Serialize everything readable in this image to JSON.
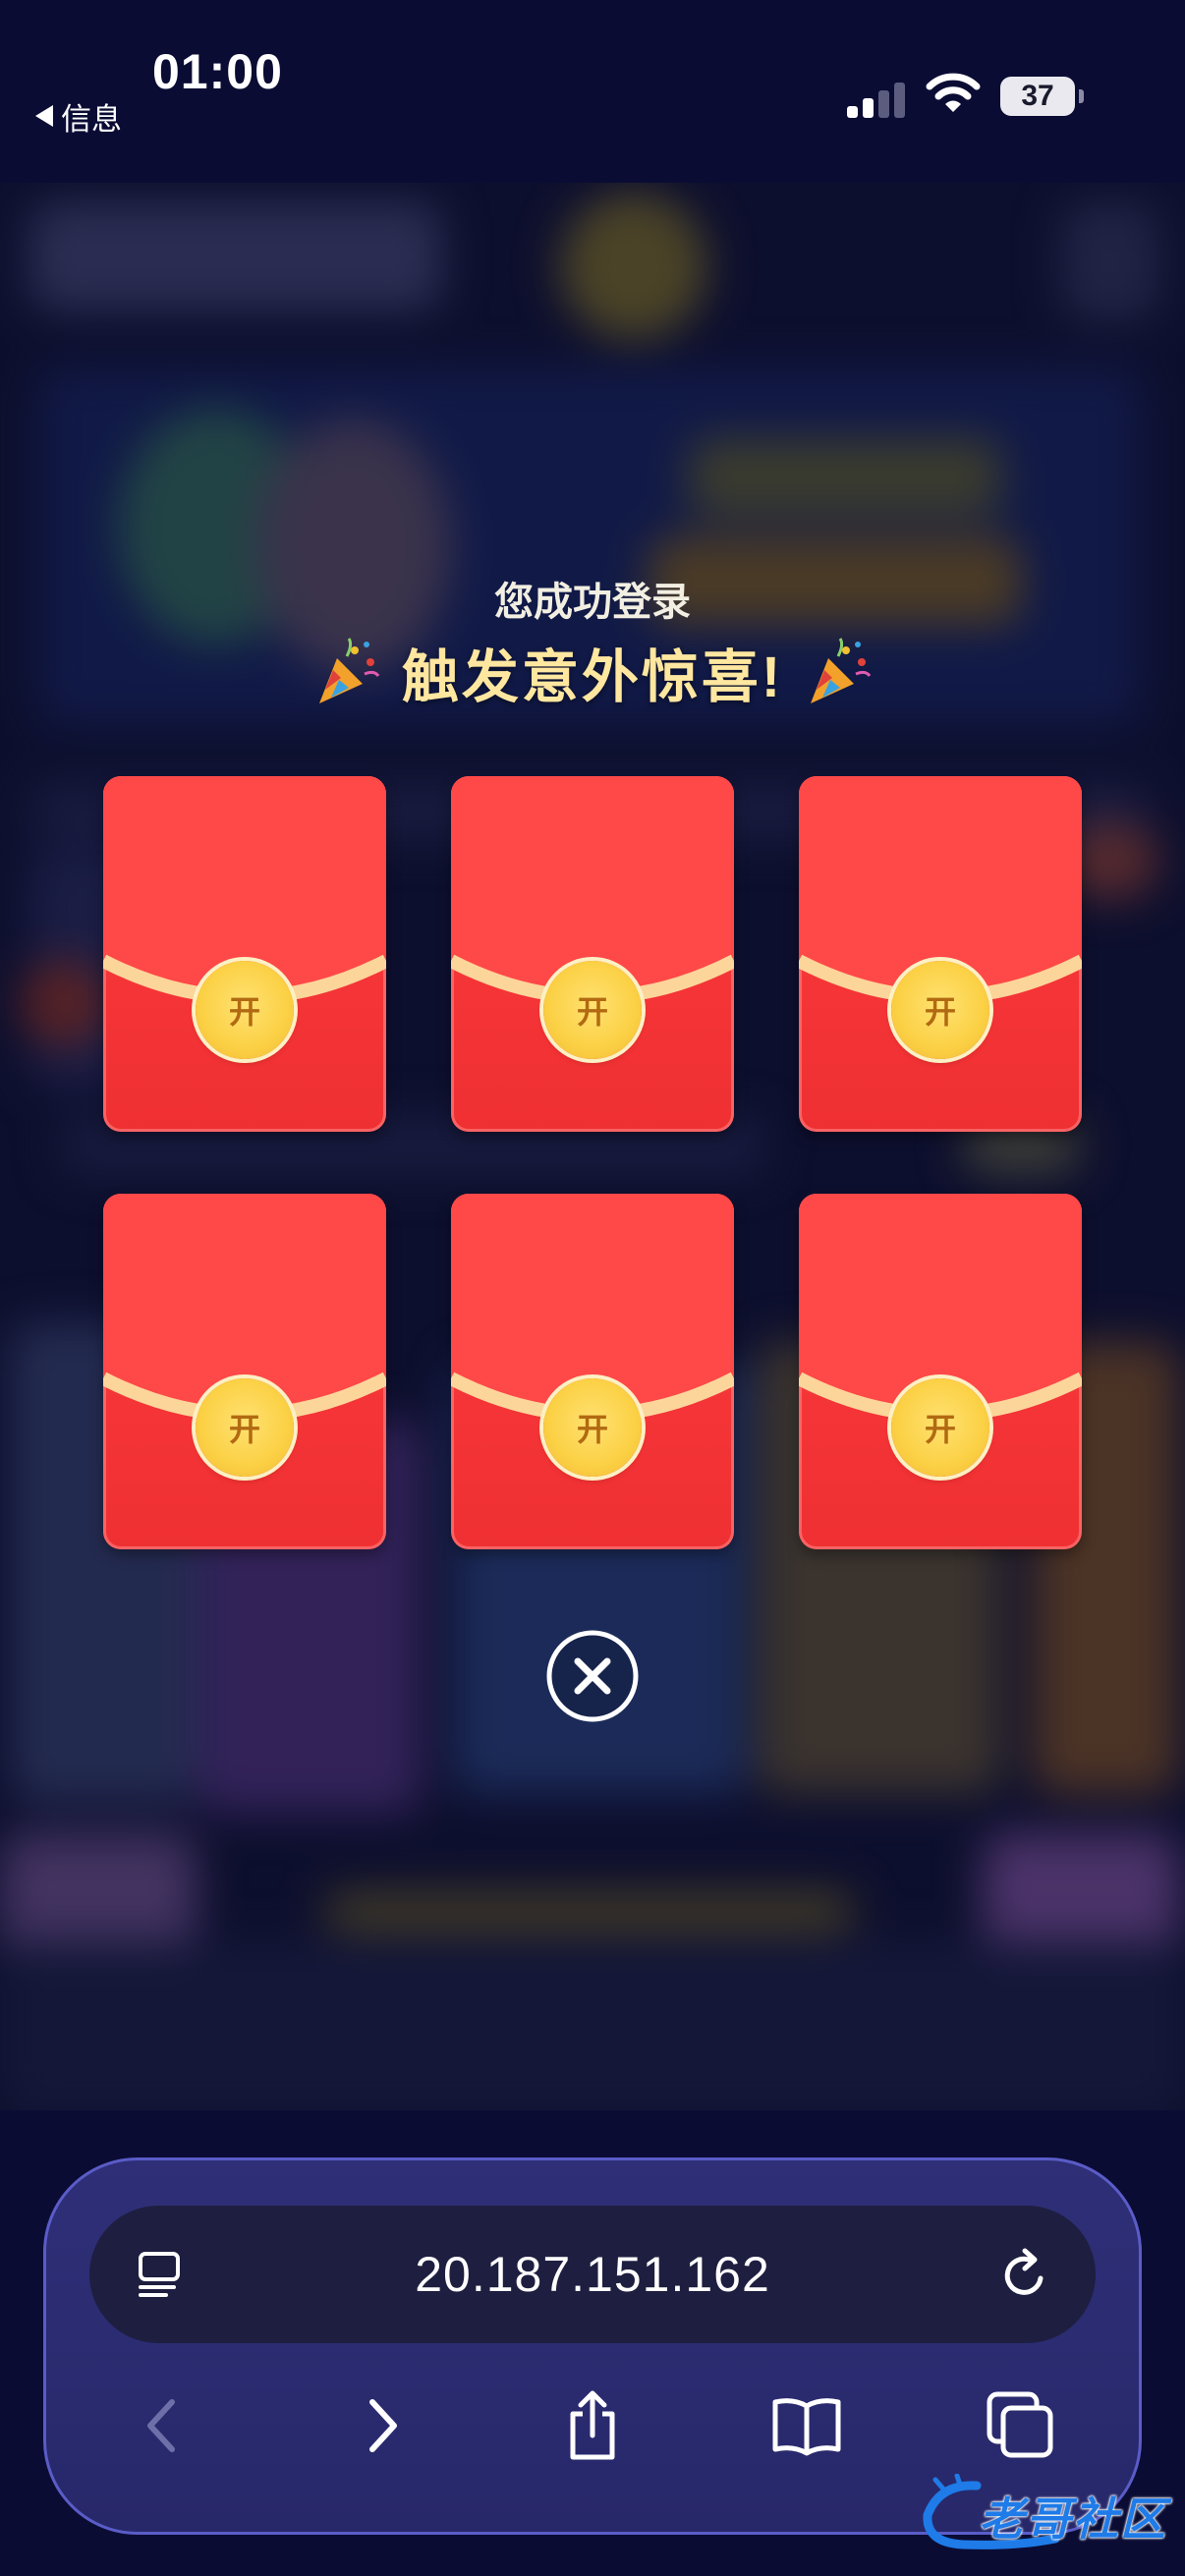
{
  "status_bar": {
    "back_label": "信息",
    "time": "01:00",
    "battery_percent": "37"
  },
  "popup": {
    "subtitle": "您成功登录",
    "title": "触发意外惊喜!",
    "envelope_open_label": "开",
    "envelope_count": 6
  },
  "browser": {
    "address": "20.187.151.162"
  },
  "icons": {
    "back": "chevron-left-icon",
    "forward": "chevron-right-icon",
    "share": "share-icon",
    "bookmarks": "book-icon",
    "tabs": "tabs-icon",
    "reader": "reader-icon",
    "reload": "reload-icon",
    "close": "close-icon"
  },
  "colors": {
    "background": "#0b0c34",
    "envelope_red": "#f43436",
    "coin_gold": "#fbd044",
    "title_gold": "#ffe7a0",
    "browser_bar": "#2f2f78"
  }
}
